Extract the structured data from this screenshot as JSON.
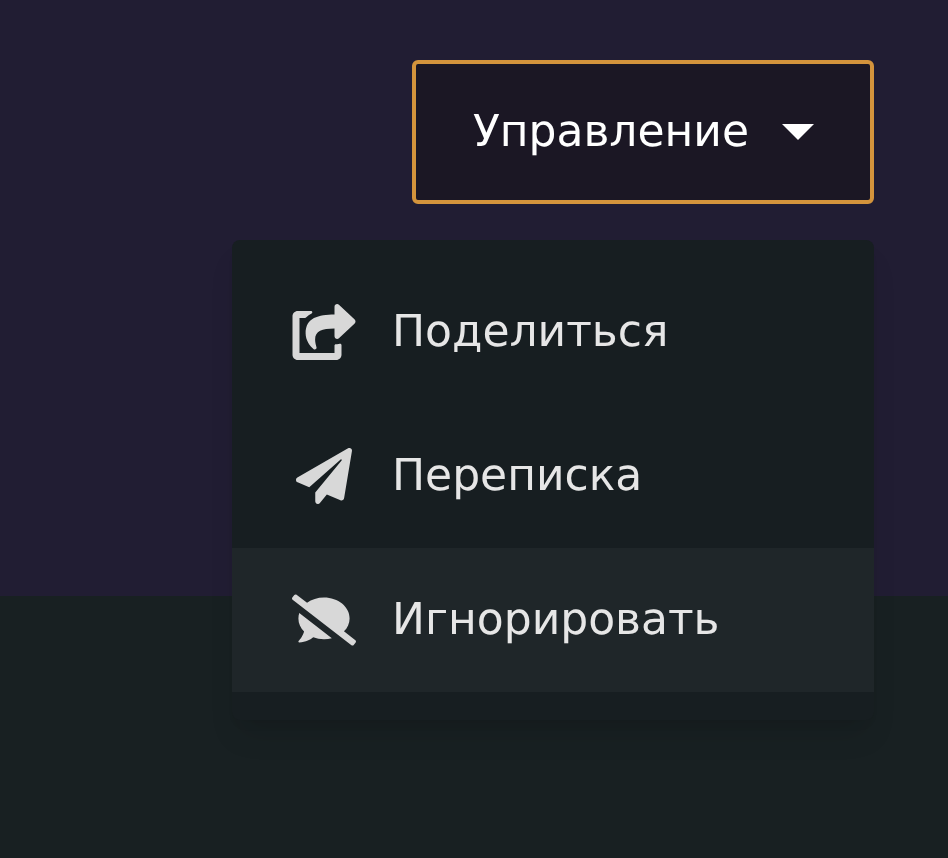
{
  "menu_button": {
    "label": "Управление",
    "expanded": true
  },
  "menu": {
    "items": [
      {
        "kind": "share",
        "label": "Поделиться",
        "highlighted": false
      },
      {
        "kind": "message",
        "label": "Переписка",
        "highlighted": false
      },
      {
        "kind": "ignore",
        "label": "Игнорировать",
        "highlighted": true
      }
    ]
  }
}
